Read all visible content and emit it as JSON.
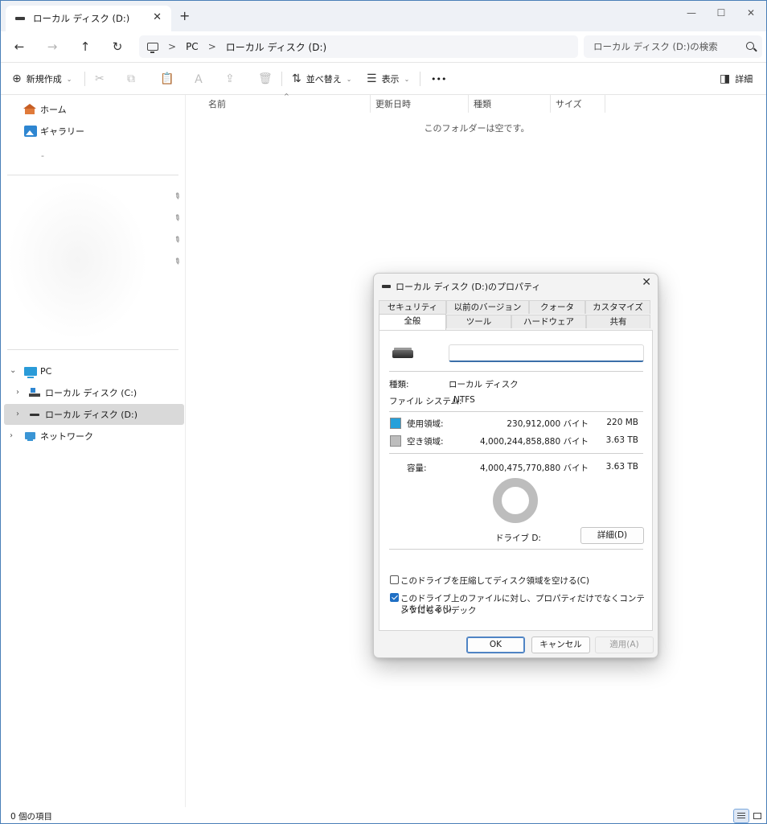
{
  "window": {
    "tab_title": "ローカル ディスク (D:)",
    "tab_close": "✕",
    "new_tab": "+",
    "minimize": "—",
    "maximize": "☐",
    "close": "✕"
  },
  "nav": {
    "back": "←",
    "forward": "→",
    "up": "↑",
    "refresh": "↻",
    "breadcrumb": [
      "PC",
      "ローカル ディスク (D:)"
    ],
    "breadcrumb_sep": ">",
    "search_placeholder": "ローカル ディスク (D:)の検索"
  },
  "toolbar": {
    "new_label": "新規作成",
    "sort_label": "並べ替え",
    "view_label": "表示",
    "more_label": "•••",
    "details_label": "詳細",
    "icons": [
      "cut-icon",
      "copy-icon",
      "paste-icon",
      "rename-icon",
      "share-icon",
      "delete-icon"
    ]
  },
  "sidebar": {
    "home": "ホーム",
    "gallery": "ギャラリー",
    "blurred_item": "-",
    "pc": "PC",
    "c_drive": "ローカル ディスク (C:)",
    "d_drive": "ローカル ディスク (D:)",
    "network": "ネットワーク",
    "pin_glyph": "📌"
  },
  "content": {
    "columns": [
      "名前",
      "更新日時",
      "種類",
      "サイズ"
    ],
    "empty_message": "このフォルダーは空です。"
  },
  "status": {
    "item_count": "0 個の項目"
  },
  "dialog": {
    "title": "ローカル ディスク (D:)のプロパティ",
    "close": "✕",
    "tabs_top": [
      "セキュリティ",
      "以前のバージョン",
      "クォータ",
      "カスタマイズ"
    ],
    "tabs_bottom": [
      "全般",
      "ツール",
      "ハードウェア",
      "共有"
    ],
    "volume_name_value": "",
    "type_label": "種類:",
    "type_value": "ローカル ディスク",
    "fs_label": "ファイル システム:",
    "fs_value": "NTFS",
    "used_label": "使用領域:",
    "used_bytes": "230,912,000 バイト",
    "used_size": "220 MB",
    "free_label": "空き領域:",
    "free_bytes": "4,000,244,858,880 バイト",
    "free_size": "3.63 TB",
    "capacity_label": "容量:",
    "capacity_bytes": "4,000,475,770,880 バイト",
    "capacity_size": "3.63 TB",
    "drive_label": "ドライブ D:",
    "details_button": "詳細(D)",
    "compress_label": "このドライブを圧縮してディスク領域を空ける(C)",
    "compress_checked": false,
    "index_label_line1": "このドライブ上のファイルに対し、プロパティだけでなくコンテンツにもインデック",
    "index_label_line2": "スを付ける(I)",
    "index_checked": true,
    "ok": "OK",
    "cancel": "キャンセル",
    "apply": "適用(A)",
    "used_color": "#26a0da",
    "free_color": "#bdbdbd"
  }
}
